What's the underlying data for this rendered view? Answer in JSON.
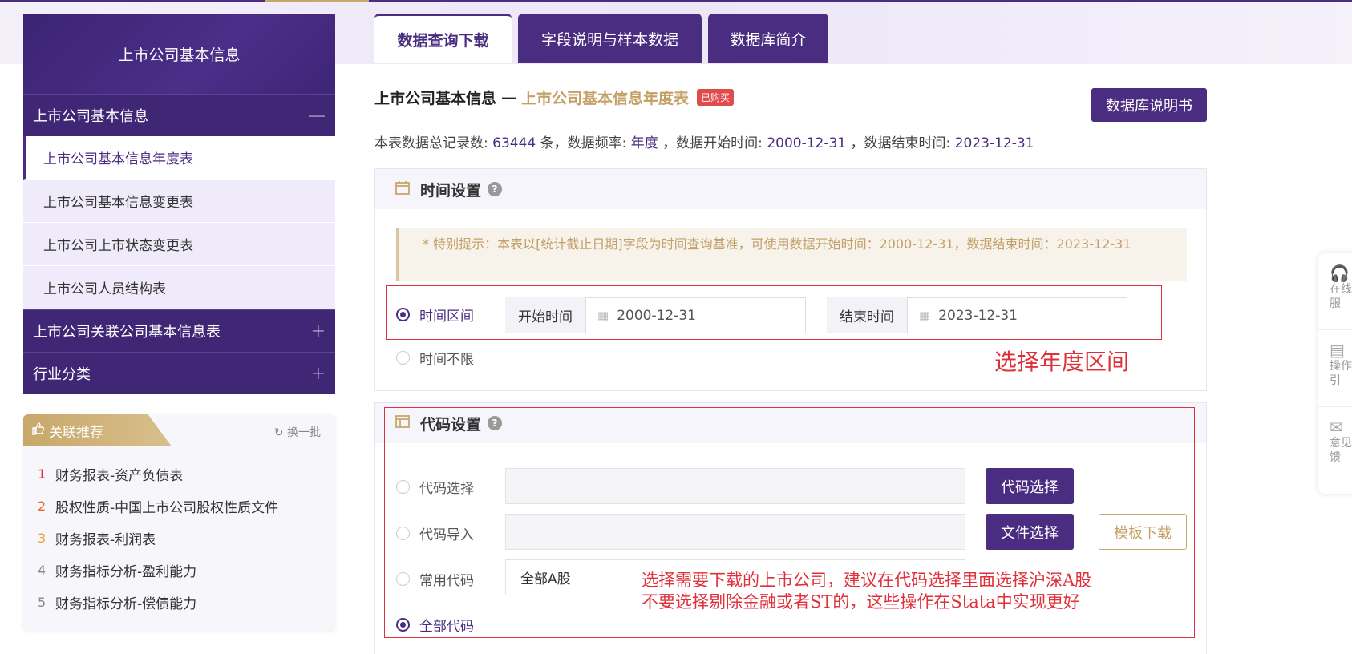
{
  "sidebar": {
    "header": "上市公司基本信息",
    "groups": [
      {
        "label": "上市公司基本信息",
        "sign": "—",
        "items": [
          "上市公司基本信息年度表",
          "上市公司基本信息变更表",
          "上市公司上市状态变更表",
          "上市公司人员结构表"
        ]
      },
      {
        "label": "上市公司关联公司基本信息表",
        "sign": "+"
      },
      {
        "label": "行业分类",
        "sign": "+"
      }
    ]
  },
  "recommend": {
    "title": "关联推荐",
    "refresh": "换一批",
    "items": [
      {
        "num": "1",
        "label": "财务报表-资产负债表",
        "color": "#e0303a"
      },
      {
        "num": "2",
        "label": "股权性质-中国上市公司股权性质文件",
        "color": "#e86a2c"
      },
      {
        "num": "3",
        "label": "财务报表-利润表",
        "color": "#e8a02c"
      },
      {
        "num": "4",
        "label": "财务指标分析-盈利能力",
        "color": "#888888"
      },
      {
        "num": "5",
        "label": "财务指标分析-偿债能力",
        "color": "#888888"
      }
    ]
  },
  "tabs": [
    "数据查询下载",
    "字段说明与样本数据",
    "数据库简介"
  ],
  "header": {
    "db": "上市公司基本信息",
    "sep": "—",
    "table": "上市公司基本信息年度表",
    "badge": "已购买",
    "manual_button": "数据库说明书"
  },
  "stats": {
    "p1": "本表数据总记录数:",
    "records": "63444",
    "p2": "条，数据频率:",
    "freq": "年度",
    "p3": "，数据开始时间:",
    "start": "2000-12-31",
    "p4": "，数据结束时间:",
    "end": "2023-12-31"
  },
  "time_panel": {
    "title": "时间设置",
    "notice": "* 特别提示：本表以[统计截止日期]字段为时间查询基准，可使用数据开始时间：2000-12-31，数据结束时间：2023-12-31",
    "opt_range": "时间区间",
    "start_label": "开始时间",
    "start_value": "2000-12-31",
    "end_label": "结束时间",
    "end_value": "2023-12-31",
    "opt_unlimited": "时间不限",
    "annotation": "选择年度区间"
  },
  "code_panel": {
    "title": "代码设置",
    "opt_select": "代码选择",
    "btn_select": "代码选择",
    "opt_import": "代码导入",
    "btn_file": "文件选择",
    "btn_template": "模板下载",
    "opt_common": "常用代码",
    "common_value": "全部A股",
    "opt_all": "全部代码",
    "annotation1": "选择需要下载的上市公司，建议在代码选择里面选择沪深A股",
    "annotation2": "不要选择剔除金融或者ST的，这些操作在Stata中实现更好"
  },
  "float_bar": [
    {
      "icon": "headset-icon",
      "label": "在线客服"
    },
    {
      "icon": "guide-icon",
      "label": "操作指引"
    },
    {
      "icon": "feedback-icon",
      "label": "意见反馈"
    }
  ],
  "colors": {
    "primary": "#4a2d80",
    "gold": "#c8a86a",
    "annotation": "#e0303a"
  }
}
